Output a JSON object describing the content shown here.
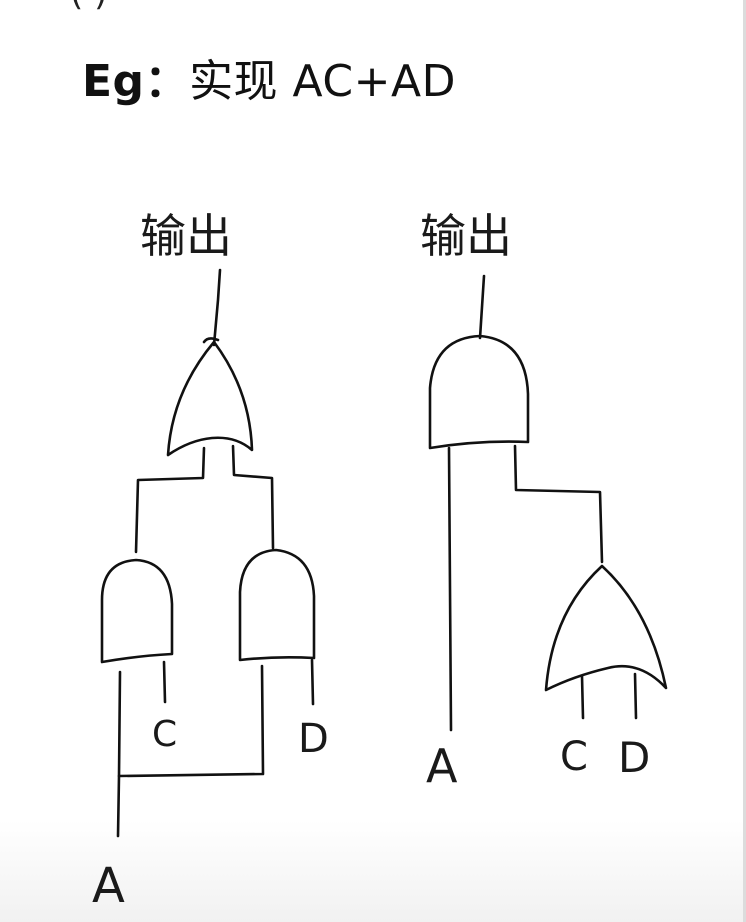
{
  "heading": {
    "prefix": "Eg：",
    "expression": "实现 AC+AD"
  },
  "cut_text": "(        )     ",
  "circuits": {
    "left": {
      "output_label": "输出",
      "input_a": "A",
      "input_c": "C",
      "input_d": "D"
    },
    "right": {
      "output_label": "输出",
      "input_a": "A",
      "input_c": "C",
      "input_d": "D"
    }
  },
  "colors": {
    "ink": "#111111",
    "background": "#ffffff"
  }
}
